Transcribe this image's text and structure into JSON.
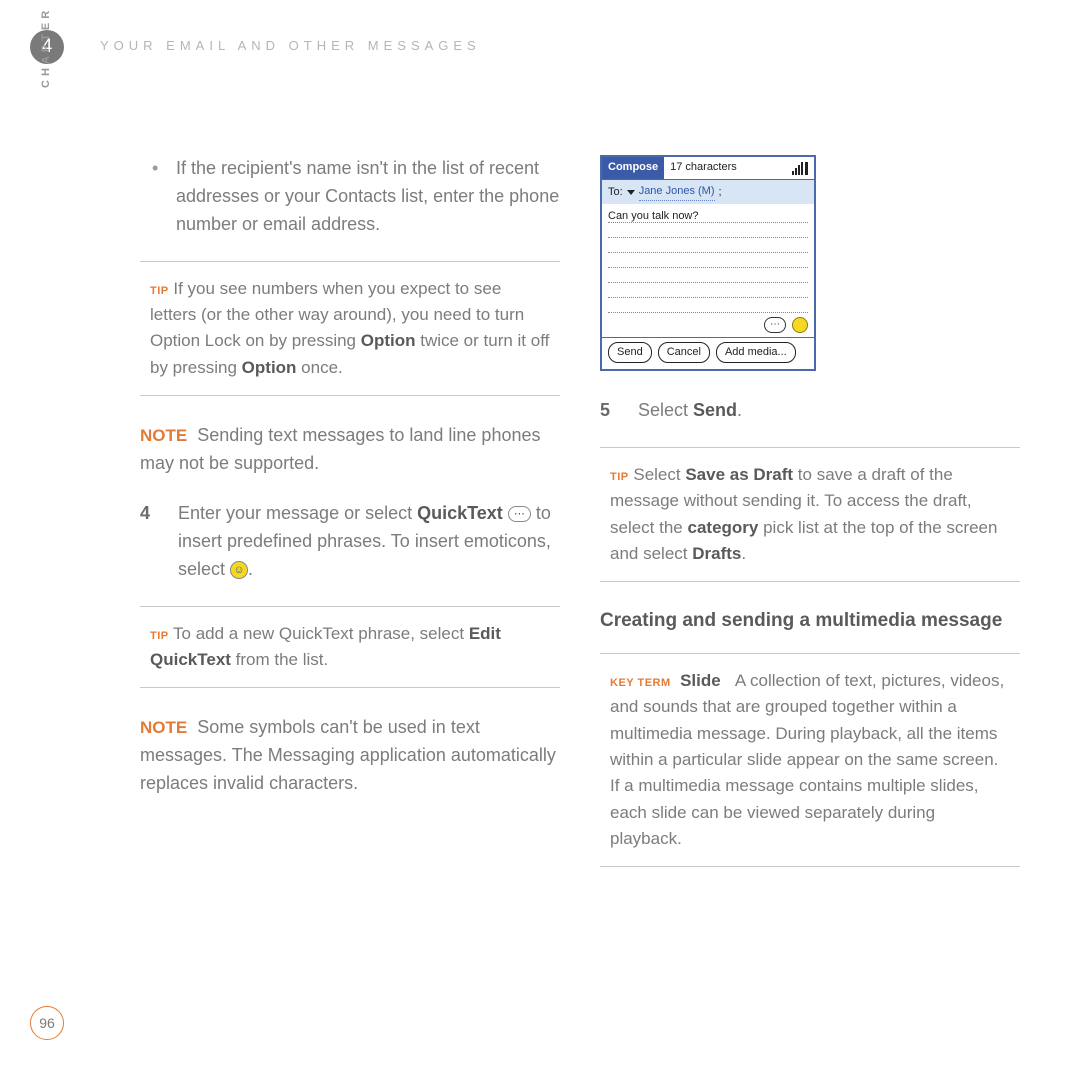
{
  "chapter": {
    "number": "4",
    "label": "CHAPTER"
  },
  "runningHead": "YOUR EMAIL AND OTHER MESSAGES",
  "pageNumber": "96",
  "left": {
    "bullet1": "If the recipient's name isn't in the list of recent addresses or your Contacts list, enter the phone number or email address.",
    "tip1_label": "TIP",
    "tip1_a": "If you see numbers when you expect to see letters (or the other way around), you need to turn Option Lock on by pressing ",
    "tip1_b": " twice or turn it off by pressing ",
    "tip1_c": " once.",
    "option": "Option",
    "note1_label": "NOTE",
    "note1": "Sending text messages to land line phones may not be supported.",
    "step4_num": "4",
    "step4_a": "Enter your message or select ",
    "step4_qt": "QuickText",
    "step4_b": " to insert predefined phrases. To insert emoticons, select ",
    "step4_c": ".",
    "tip2_label": "TIP",
    "tip2_a": "To add a new QuickText phrase, select ",
    "tip2_bold": "Edit QuickText",
    "tip2_b": " from the list.",
    "note2_label": "NOTE",
    "note2": "Some symbols can't be used in text messages. The Messaging application automatically replaces invalid characters."
  },
  "device": {
    "compose": "Compose",
    "chars": "17 characters",
    "toLabel": "To:",
    "toName": "Jane Jones (M)",
    "toSep": ";",
    "msg": "Can you talk now?",
    "qtBtn": "⋯",
    "send": "Send",
    "cancel": "Cancel",
    "addMedia": "Add media..."
  },
  "right": {
    "step5_num": "5",
    "step5_a": "Select ",
    "step5_b": "Send",
    "step5_c": ".",
    "tip3_label": "TIP",
    "tip3_a": "Select ",
    "tip3_bold1": "Save as Draft",
    "tip3_b": " to save a draft of the message without sending it. To access the draft, select the ",
    "tip3_bold2": "category",
    "tip3_c": " pick list at the top of the screen and select ",
    "tip3_bold3": "Drafts",
    "tip3_d": ".",
    "h2": "Creating and sending a multimedia message",
    "kt_label": "KEY TERM",
    "kt_term": "Slide",
    "kt_body": "A collection of text, pictures, videos, and sounds that are grouped together within a multimedia message. During playback, all the items within a particular slide appear on the same screen. If a multimedia message contains multiple slides, each slide can be viewed separately during playback."
  }
}
